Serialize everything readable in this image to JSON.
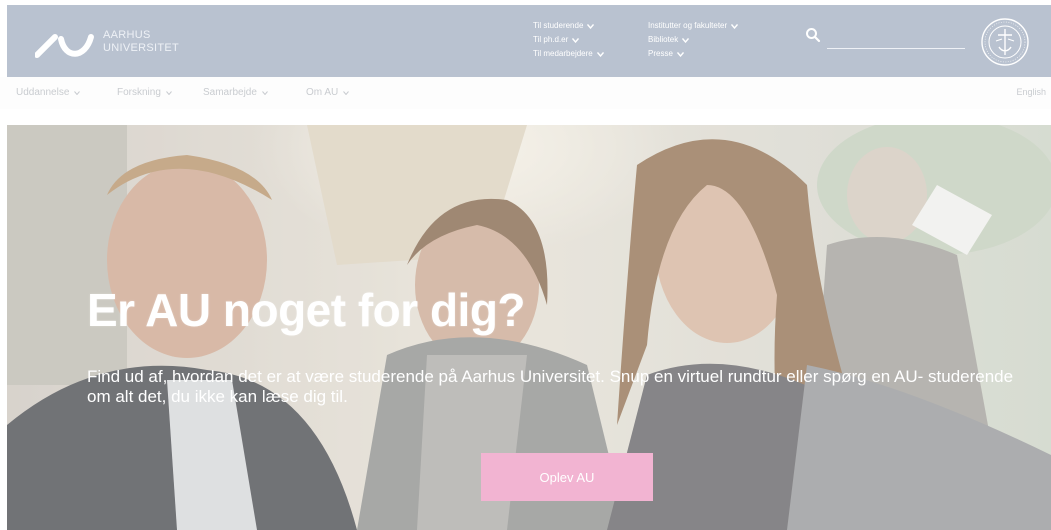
{
  "header": {
    "logo_line1": "AARHUS",
    "logo_line2": "UNIVERSITET",
    "links_col1": [
      {
        "label": "Til studerende"
      },
      {
        "label": "Til ph.d.er"
      },
      {
        "label": "Til medarbejdere"
      }
    ],
    "links_col2": [
      {
        "label": "Institutter og fakulteter"
      },
      {
        "label": "Bibliotek"
      },
      {
        "label": "Presse"
      }
    ],
    "search_placeholder": ""
  },
  "subnav": {
    "items": [
      {
        "label": "Uddannelse"
      },
      {
        "label": "Forskning"
      },
      {
        "label": "Samarbejde"
      },
      {
        "label": "Om AU"
      }
    ],
    "language": "English"
  },
  "hero": {
    "title": "Er AU noget for dig?",
    "text": "Find ud af, hvordan det er at være studerende på Aarhus Universitet. Snup en virtuel rundtur eller spørg en AU- studerende om alt det, du ikke kan læse dig til.",
    "cta_label": "Oplev AU"
  },
  "colors": {
    "header_bg": "#b9c2d0",
    "cta_bg": "#f2b4d2",
    "subnav_text": "#c9ccd0"
  },
  "icons": {
    "logo": "au-logo-icon",
    "search": "search-icon",
    "seal": "university-seal-icon",
    "chevron": "chevron-down-icon"
  }
}
